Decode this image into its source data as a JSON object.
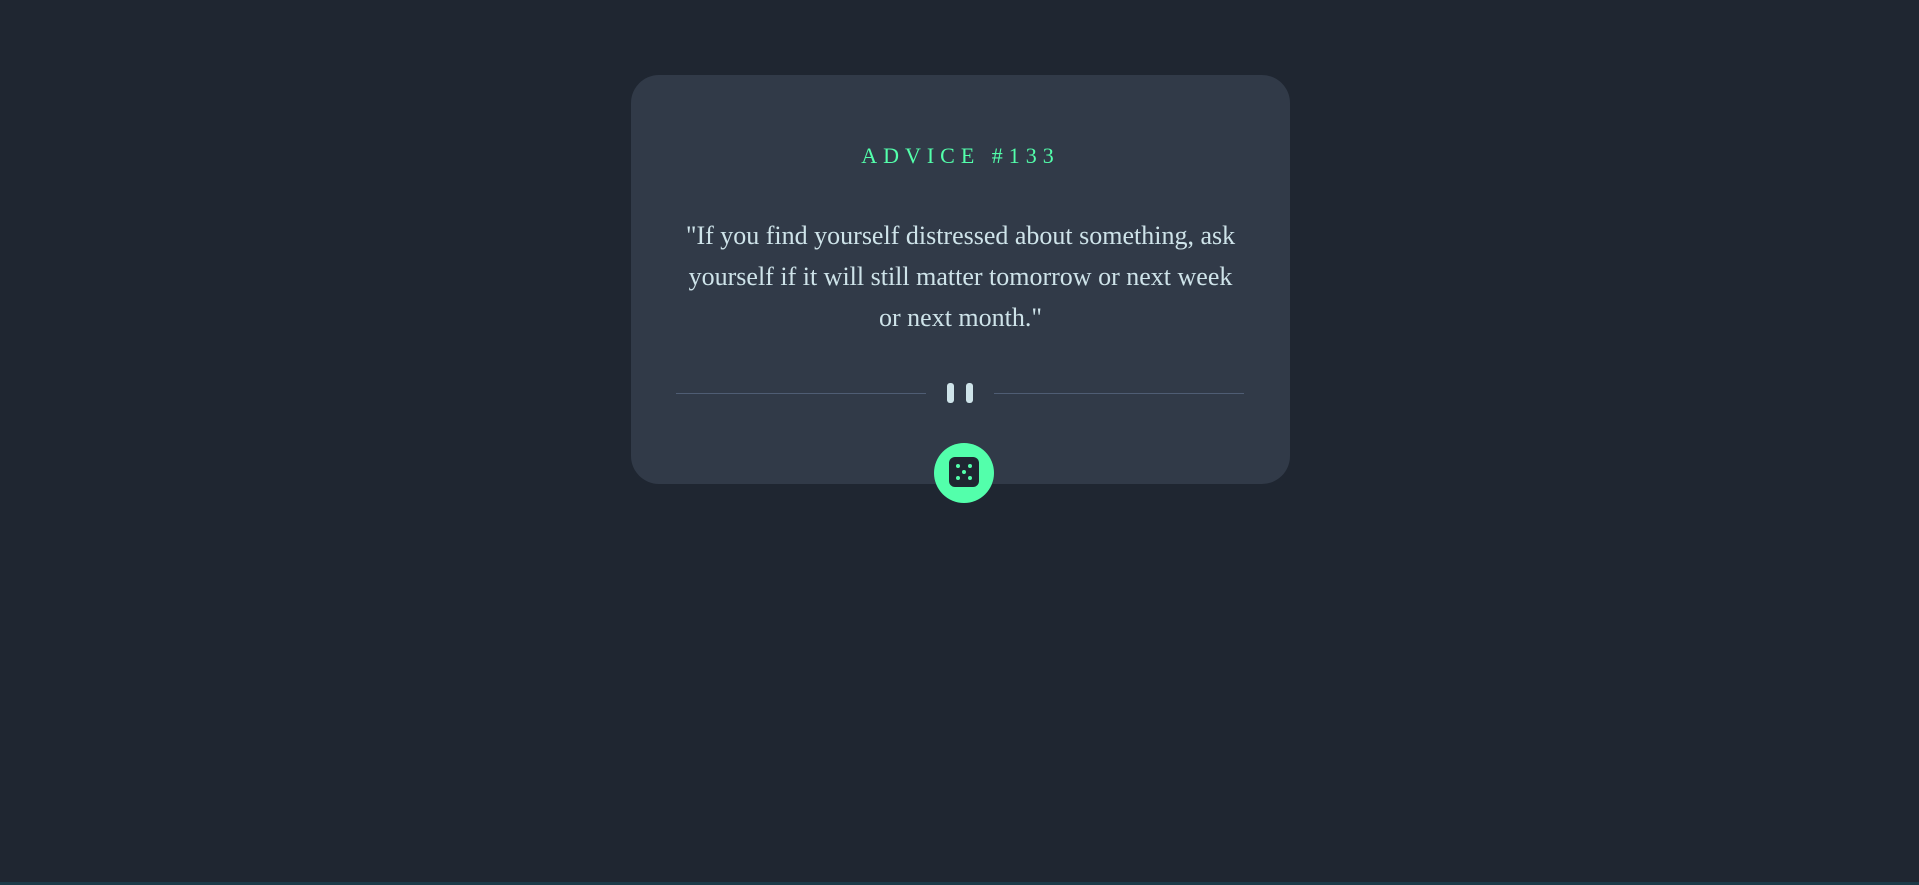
{
  "advice": {
    "label": "ADVICE #133",
    "quote": "\"If you find yourself distressed about something, ask yourself if it will still matter tomorrow or next week or next month.\""
  },
  "divider": {
    "icon": "pause-icon"
  },
  "dice_button": {
    "icon": "dice-icon"
  },
  "colors": {
    "background": "#1f2631",
    "card": "#313a48",
    "accent": "#53ffab",
    "text": "#cee3e9",
    "divider": "#4f5d74"
  }
}
